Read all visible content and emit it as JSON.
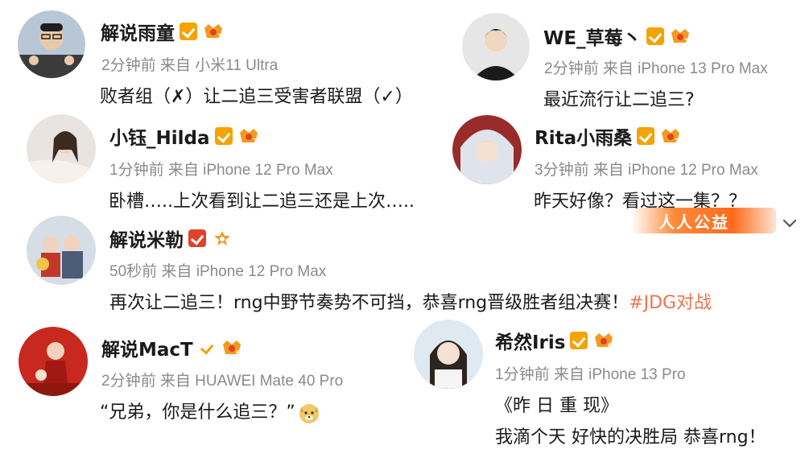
{
  "colors": {
    "accent": "#eb7350",
    "meta": "#8a8a8a",
    "vip": "#f4a300",
    "vip_red": "#e0412a"
  },
  "posts": [
    {
      "name": "解说雨童",
      "time": "2分钟前",
      "from": "来自",
      "device": "小米11 Ultra",
      "text": "败者组（✗）让二追三受害者联盟（✓）"
    },
    {
      "name": "WE_草莓丶",
      "time": "2分钟前",
      "from": "来自",
      "device": "iPhone 13 Pro Max",
      "text": "最近流行让二追三?"
    },
    {
      "name": "小钰_Hilda",
      "time": "1分钟前",
      "from": "来自",
      "device": "iPhone 12 Pro Max",
      "text": "卧槽…..上次看到让二追三还是上次….."
    },
    {
      "name": "Rita小雨桑",
      "time": "3分钟前",
      "from": "来自",
      "device": "iPhone 12 Pro Max",
      "text": "昨天好像？看过这一集？？"
    },
    {
      "name": "解说米勒",
      "time": "50秒前",
      "from": "来自",
      "device": "iPhone 12 Pro Max",
      "text": "再次让二追三！rng中野节奏势不可挡，恭喜rng晋级胜者组决赛！",
      "hashtag": "#JDG对战"
    },
    {
      "name": "解说MacT",
      "time": "2分钟前",
      "from": "来自",
      "device": "HUAWEI Mate 40 Pro",
      "text": "“兄弟，你是什么追三？”"
    },
    {
      "name": "希然Iris",
      "time": "1分钟前",
      "from": "来自",
      "device": "iPhone 13 Pro",
      "text": "《昨 日 重 现》",
      "text2": "我滴个天 好快的决胜局 恭喜rng！"
    }
  ],
  "promo": {
    "label": "人人公益"
  }
}
